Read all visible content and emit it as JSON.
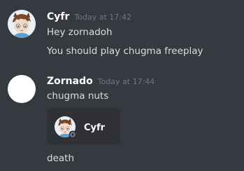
{
  "messages": [
    {
      "username": "Cyfr",
      "timestamp": "Today at 17:42",
      "lines": [
        "Hey zornadoh",
        "You should play chugma freeplay"
      ]
    },
    {
      "username": "Zornado",
      "timestamp": "Today at 17:44",
      "lines": [
        "chugma nuts"
      ],
      "embed": {
        "name": "Cyfr"
      },
      "after_embed": [
        "death"
      ]
    }
  ],
  "colors": {
    "background": "#36393f",
    "username": "#ffffff",
    "timestamp": "#72767d",
    "text": "#dcddde",
    "embed_background": "#2f3136"
  },
  "icons": {
    "cyfr_avatar": "cartoon-character-avatar-icon",
    "zornado_avatar": "white-circle-avatar-icon",
    "embed_status": "offline-status-icon"
  }
}
